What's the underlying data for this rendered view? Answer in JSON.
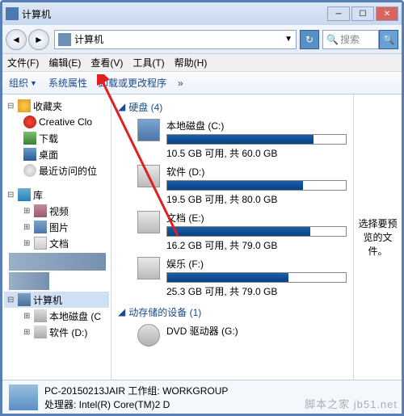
{
  "title": "计算机",
  "address": "计算机",
  "search_placeholder": "搜索",
  "menubar": [
    "文件(F)",
    "编辑(E)",
    "查看(V)",
    "工具(T)",
    "帮助(H)"
  ],
  "toolbar": {
    "organize": "组织",
    "sysprops": "系统属性",
    "uninstall": "卸载或更改程序",
    "chev": "»"
  },
  "tree": {
    "fav": "收藏夹",
    "cc": "Creative Clo",
    "dl": "下载",
    "desk": "桌面",
    "recent": "最近访问的位",
    "lib": "库",
    "vid": "视频",
    "pic": "图片",
    "doc": "文档",
    "comp": "计算机",
    "c": "本地磁盘 (C",
    "d": "软件 (D:)"
  },
  "main": {
    "hdd_section": "硬盘 (4)",
    "drives": [
      {
        "name": "本地磁盘 (C:)",
        "info": "10.5 GB 可用, 共 60.0 GB",
        "pct": 82
      },
      {
        "name": "软件 (D:)",
        "info": "19.5 GB 可用, 共 80.0 GB",
        "pct": 76
      },
      {
        "name": "文档 (E:)",
        "info": "16.2 GB 可用, 共 79.0 GB",
        "pct": 80
      },
      {
        "name": "娱乐 (F:)",
        "info": "25.3 GB 可用, 共 79.0 GB",
        "pct": 68
      }
    ],
    "removable_section": "动存储的设备 (1)",
    "dvd": "DVD 驱动器 (G:)"
  },
  "preview": "选择要预览的文件。",
  "status": {
    "line1": "PC-20150213JAIR 工作组: WORKGROUP",
    "line2": "处理器: Intel(R) Core(TM)2 D"
  },
  "watermark": "脚本之家  jb51.net"
}
